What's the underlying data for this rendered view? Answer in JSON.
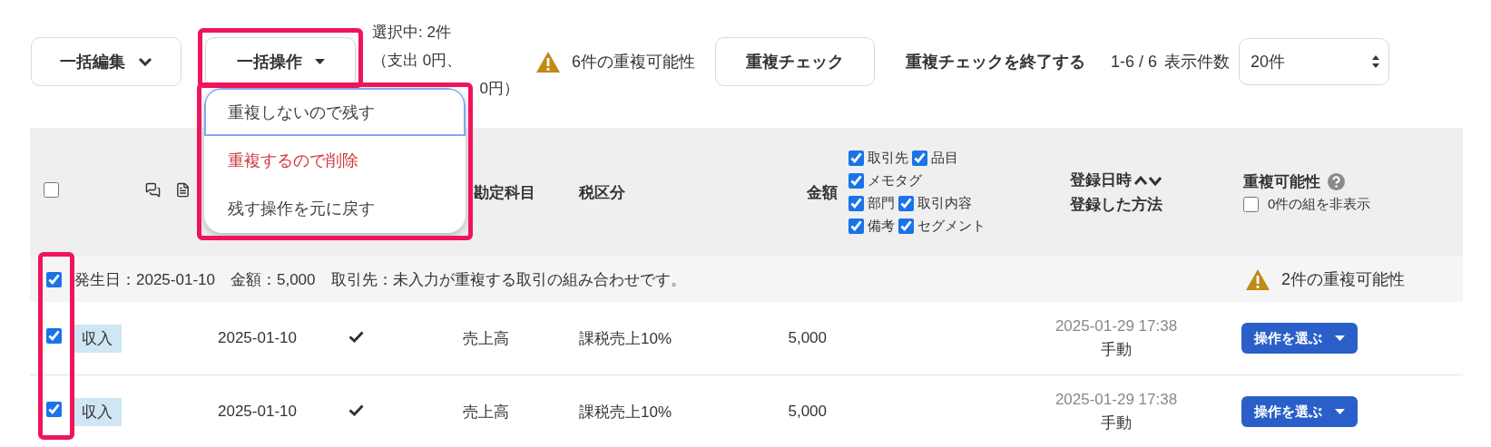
{
  "toolbar": {
    "bulk_edit": "一括編集",
    "bulk_action": "一括操作",
    "selection": [
      "選択中: 2件",
      "（支出 0円、",
      "0円）"
    ],
    "warning": "6件の重複可能性",
    "dup_check": "重複チェック",
    "end_check": "重複チェックを終了する",
    "range": "1-6 / 6",
    "per_page_label": "表示件数",
    "per_page": "20件"
  },
  "menu": {
    "items": [
      {
        "label": "重複しないので残す",
        "kind": "normal",
        "focused": true
      },
      {
        "label": "重複するので削除",
        "kind": "danger",
        "focused": false
      },
      {
        "label": "残す操作を元に戻す",
        "kind": "normal",
        "focused": false
      }
    ]
  },
  "header": {
    "select_all": false,
    "account": "勘定科目",
    "tax": "税区分",
    "amount": "金額",
    "memo_filters": [
      {
        "label": "取引先",
        "checked": true
      },
      {
        "label": "品目",
        "checked": true
      },
      {
        "label": "メモタグ",
        "checked": true
      },
      {
        "label": "部門",
        "checked": true
      },
      {
        "label": "取引内容",
        "checked": true
      },
      {
        "label": "備考",
        "checked": true
      },
      {
        "label": "セグメント",
        "checked": true
      }
    ],
    "registered": "登録日時",
    "method": "登録した方法",
    "duplicate": "重複可能性",
    "hide_option": {
      "label": "0件の組を非表示",
      "checked": false
    }
  },
  "group": {
    "checked": true,
    "text": "発生日：2025-01-10　金額：5,000　取引先：未入力が重複する取引の組み合わせです。",
    "warning": "2件の重複可能性"
  },
  "rows": [
    {
      "checked": true,
      "type": "収入",
      "date": "2025-01-10",
      "settled": true,
      "account": "売上高",
      "tax": "課税売上10%",
      "amount": "5,000",
      "registered_at": "2025-01-29 17:38",
      "method": "手動",
      "action": "操作を選ぶ"
    },
    {
      "checked": true,
      "type": "収入",
      "date": "2025-01-10",
      "settled": true,
      "account": "売上高",
      "tax": "課税売上10%",
      "amount": "5,000",
      "registered_at": "2025-01-29 17:38",
      "method": "手動",
      "action": "操作を選ぶ"
    }
  ]
}
